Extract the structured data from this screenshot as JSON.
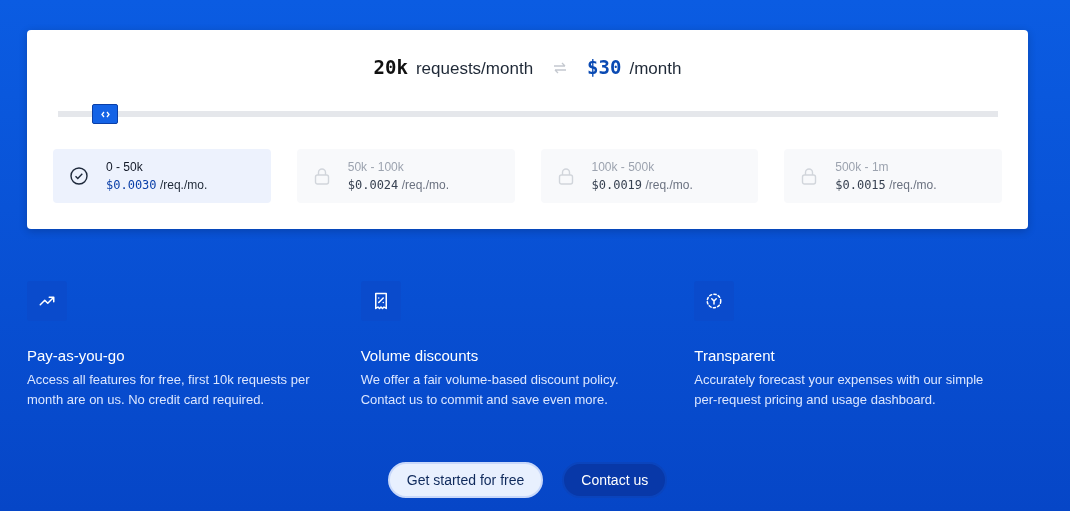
{
  "calculator": {
    "requests": "20k",
    "requests_unit": "requests/month",
    "price": "$30",
    "price_unit": "/month",
    "slider": {
      "level": 0.05
    }
  },
  "tiers": [
    {
      "range": "0 - 50k",
      "price": "$0.0030",
      "unit": "/req./mo.",
      "selected": true
    },
    {
      "range": "50k - 100k",
      "price": "$0.0024",
      "unit": "/req./mo.",
      "selected": false
    },
    {
      "range": "100k - 500k",
      "price": "$0.0019",
      "unit": "/req./mo.",
      "selected": false
    },
    {
      "range": "500k - 1m",
      "price": "$0.0015",
      "unit": "/req./mo.",
      "selected": false
    }
  ],
  "features": [
    {
      "kind": "trend",
      "title": "Pay-as-you-go",
      "text": "Access all features for free, first 10k requests per month are on us. No credit card required."
    },
    {
      "kind": "receipt",
      "title": "Volume discounts",
      "text": "We offer a fair volume-based discount policy. Contact us to commit and save even more."
    },
    {
      "kind": "scan",
      "title": "Transparent",
      "text": "Accurately forecast your expenses with our simple per-request pricing and usage dashboard."
    }
  ],
  "buttons": [
    {
      "label": "Get started for free",
      "kind": "primary"
    },
    {
      "label": "Contact us",
      "kind": "secondary"
    }
  ]
}
